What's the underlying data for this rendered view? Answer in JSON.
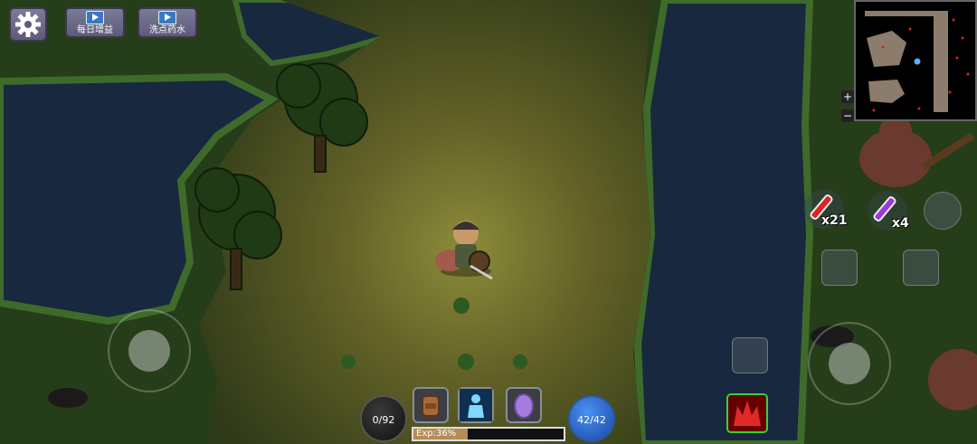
{
  "hud": {
    "settings_icon": "gear-icon",
    "daily_bonus_label": "每日增益",
    "respec_potion_label": "洗点药水",
    "hp_text": "0/92",
    "mana_text": "42/42",
    "exp_text": "Exp:36%",
    "exp_fraction": 0.36,
    "minimap_zoom_in": "+",
    "minimap_zoom_out": "−"
  },
  "potions": {
    "health_count": "x21",
    "mana_count": "x4"
  },
  "skills": [
    {
      "icon": "backpack-icon"
    },
    {
      "icon": "character-icon"
    },
    {
      "icon": "pet-egg-icon"
    }
  ],
  "colors": {
    "river": "#18283f",
    "grass": "#2d4a20",
    "path": "#6b6a2c",
    "mana_orb": "#2a6fd1",
    "hp_orb": "#1c1c1c"
  }
}
